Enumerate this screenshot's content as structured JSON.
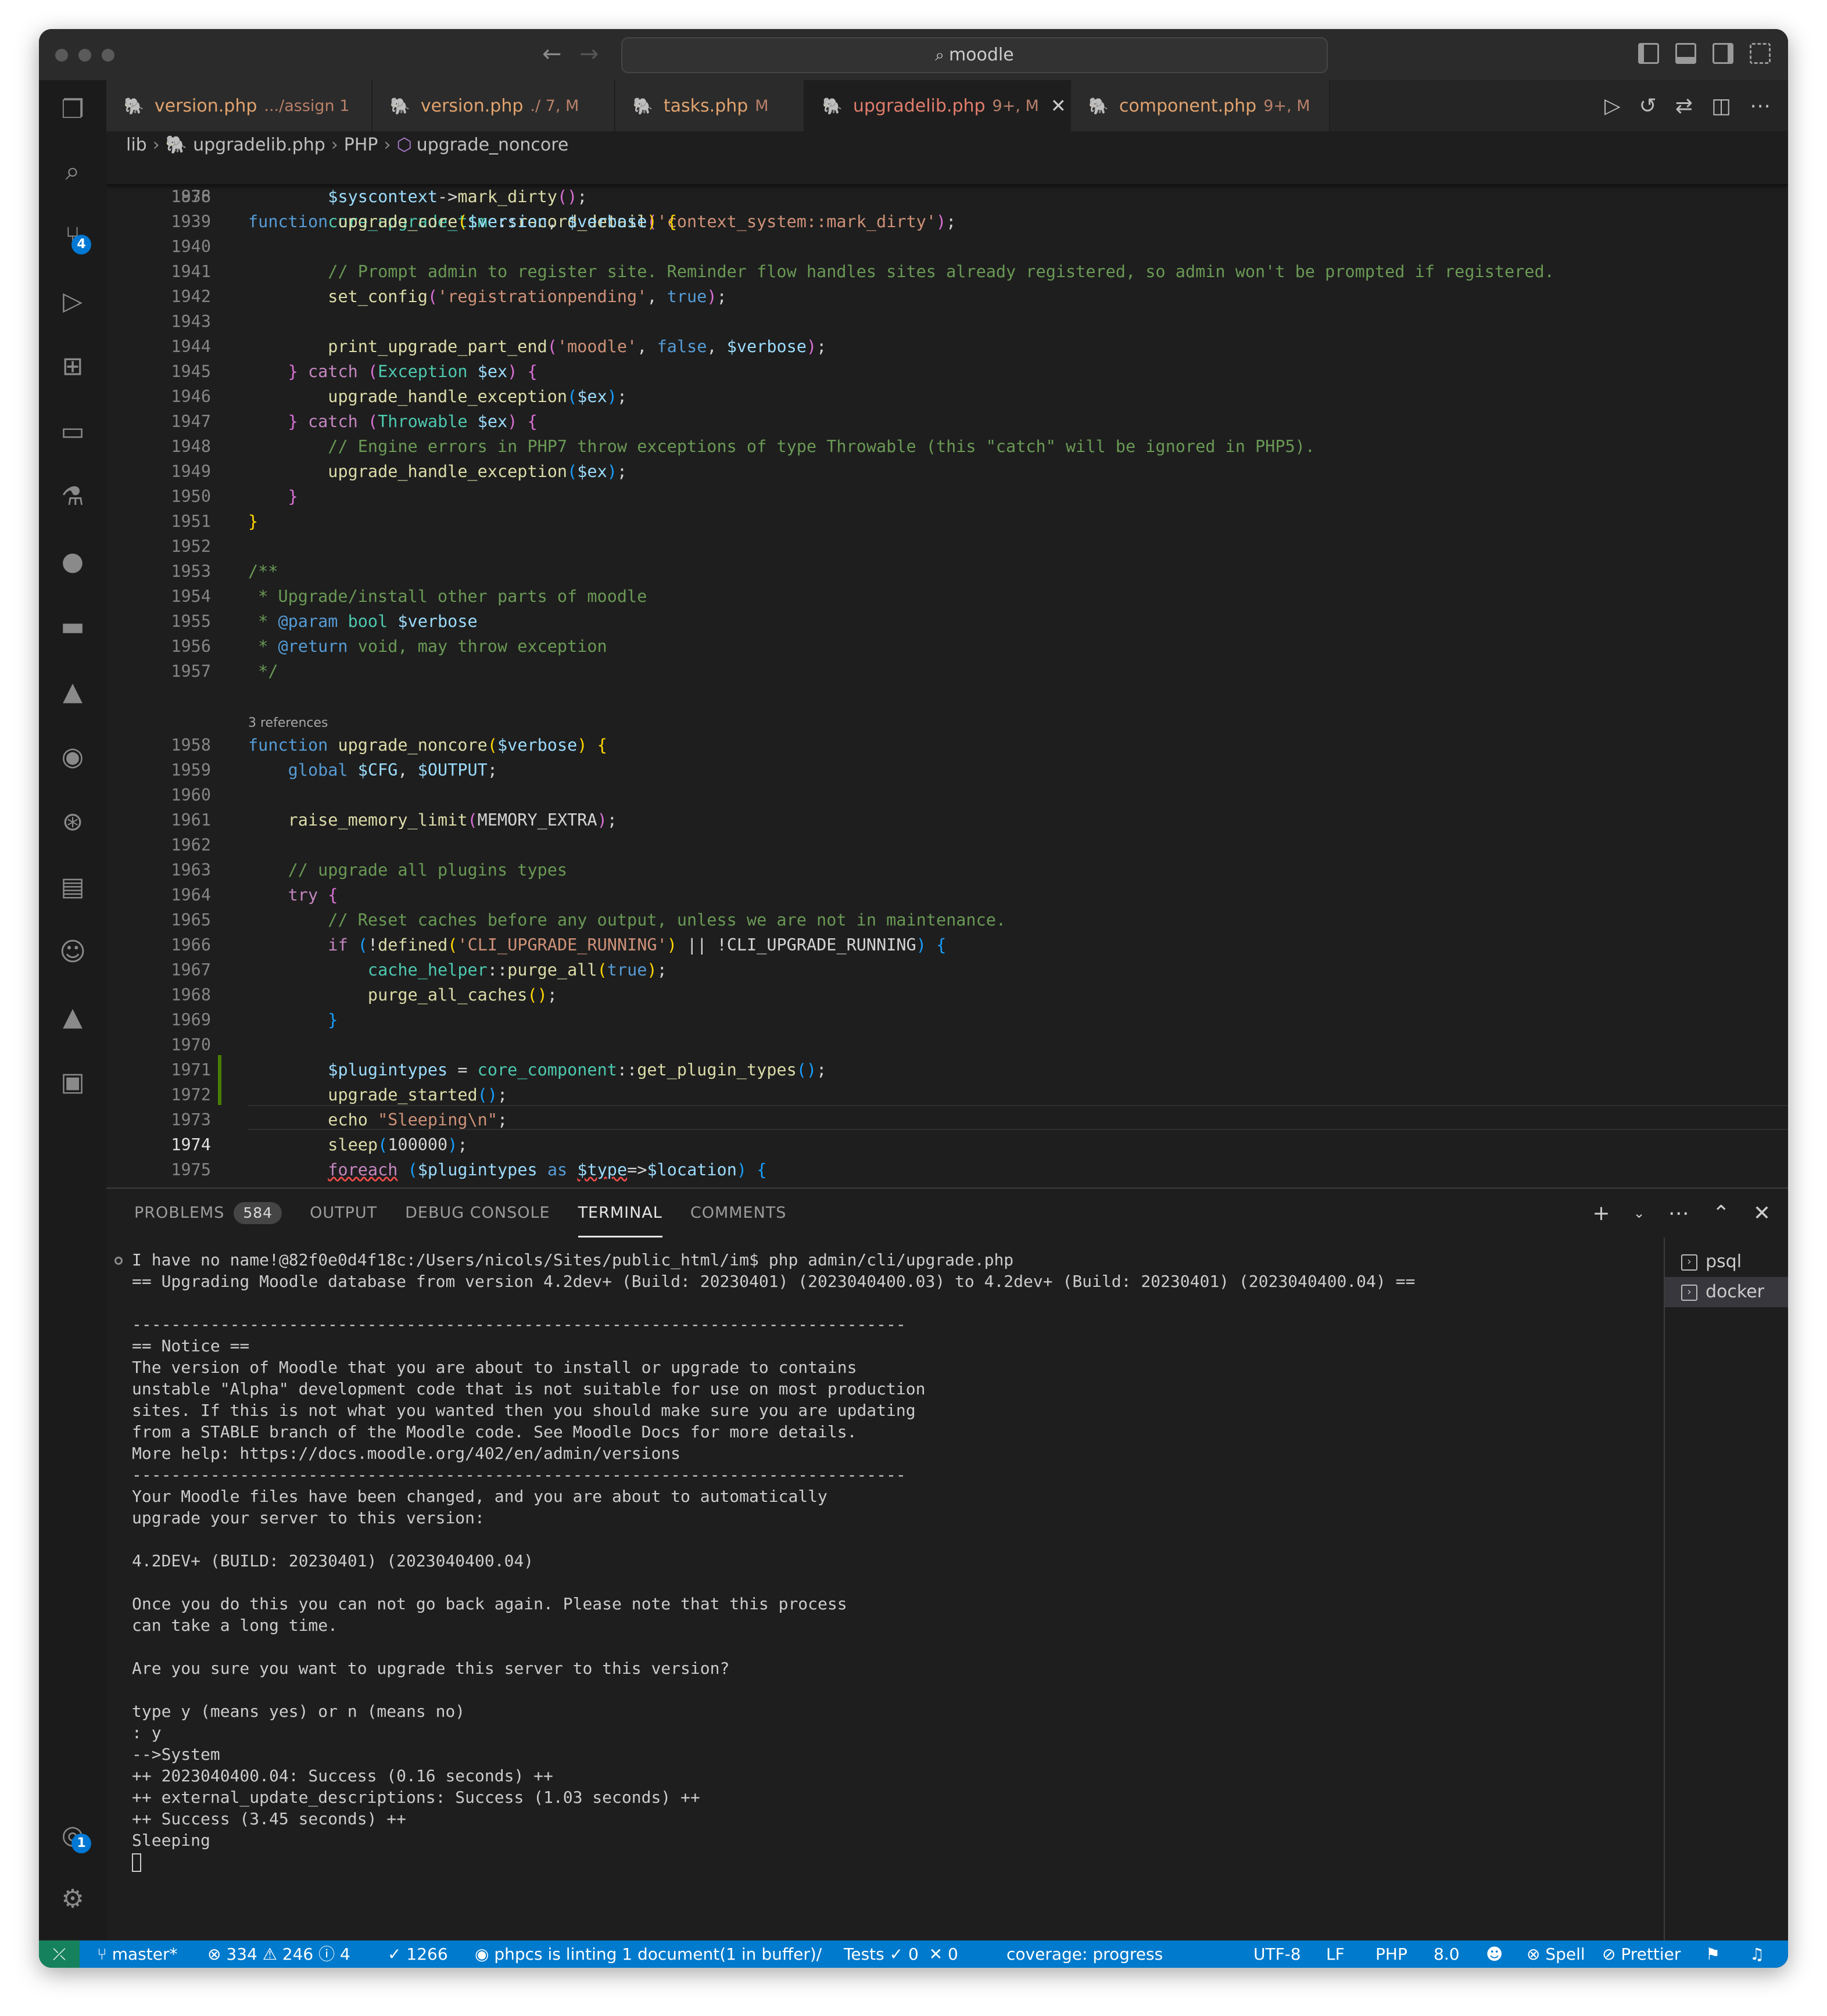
{
  "window": {
    "search_label": "moodle"
  },
  "tabs": [
    {
      "name": "version.php",
      "desc": ".../assign 1",
      "active": false
    },
    {
      "name": "version.php",
      "desc": "./ 7, M",
      "active": false
    },
    {
      "name": "tasks.php",
      "desc": "M",
      "active": false
    },
    {
      "name": "upgradelib.php",
      "desc": "9+, M",
      "active": true
    },
    {
      "name": "component.php",
      "desc": "9+, M",
      "active": false
    }
  ],
  "breadcrumb": {
    "folder": "lib",
    "file": "upgradelib.php",
    "language": "PHP",
    "symbol": "upgrade_noncore"
  },
  "editor": {
    "sticky_line": "1876",
    "line_numbers": [
      "1938",
      "1939",
      "1940",
      "1941",
      "1942",
      "1943",
      "1944",
      "1945",
      "1946",
      "1947",
      "1948",
      "1949",
      "1950",
      "1951",
      "1952",
      "1953",
      "1954",
      "1955",
      "1956",
      "1957",
      "1958",
      "1959",
      "1960",
      "1961",
      "1962",
      "1963",
      "1964",
      "1965",
      "1966",
      "1967",
      "1968",
      "1969",
      "1970",
      "1971",
      "1972",
      "1973",
      "1974",
      "1975"
    ],
    "current_line": "1974",
    "references_label": "3 references",
    "strings": {
      "s1": "'context_system::mark_dirty'",
      "s2": "'registrationpending'",
      "s3": "'moodle'",
      "s4": "'CLI_UPGRADE_RUNNING'",
      "s5": "\"Sleeping\\n\""
    },
    "comments": {
      "c1": "// Prompt admin to register site. Reminder flow handles sites already registered, so admin won't be prompted if registered.",
      "c2": "// Engine errors in PHP7 throw exceptions of type Throwable (this \"catch\" will be ignored in PHP5).",
      "c3": "/**",
      "c4": " * Upgrade/install other parts of moodle",
      "c5": " * ",
      "c5b": "@param",
      "c5c": " bool ",
      "c5d": "$verbose",
      "c6": " * ",
      "c6b": "@return",
      "c6c": " void, may throw exception",
      "c7": " */",
      "c8": "// upgrade all plugins types",
      "c9": "// Reset caches before any output, unless we are not in maintenance."
    },
    "numbers": {
      "n1": "100000"
    }
  },
  "panel": {
    "tabs": [
      {
        "label": "PROBLEMS",
        "badge": "584"
      },
      {
        "label": "OUTPUT"
      },
      {
        "label": "DEBUG CONSOLE"
      },
      {
        "label": "TERMINAL"
      },
      {
        "label": "COMMENTS"
      }
    ],
    "terminal_lines": [
      "I have no name!@82f0e0d4f18c:/Users/nicols/Sites/public_html/im$ php admin/cli/upgrade.php",
      "== Upgrading Moodle database from version 4.2dev+ (Build: 20230401) (2023040400.03) to 4.2dev+ (Build: 20230401) (2023040400.04) ==",
      "",
      "-------------------------------------------------------------------------------",
      "== Notice ==",
      "The version of Moodle that you are about to install or upgrade to contains",
      "unstable \"Alpha\" development code that is not suitable for use on most production",
      "sites. If this is not what you wanted then you should make sure you are updating",
      "from a STABLE branch of the Moodle code. See Moodle Docs for more details.",
      "More help: https://docs.moodle.org/402/en/admin/versions",
      "-------------------------------------------------------------------------------",
      "Your Moodle files have been changed, and you are about to automatically",
      "upgrade your server to this version:",
      "",
      "4.2DEV+ (BUILD: 20230401) (2023040400.04)",
      "",
      "Once you do this you can not go back again. Please note that this process",
      "can take a long time.",
      "",
      "Are you sure you want to upgrade this server to this version?",
      "",
      "type y (means yes) or n (means no)",
      ": y",
      "-->System",
      "++ 2023040400.04: Success (0.16 seconds) ++",
      "++ external_update_descriptions: Success (1.03 seconds) ++",
      "++ Success (3.45 seconds) ++",
      "Sleeping"
    ],
    "terminal_list": [
      "psql",
      "docker"
    ]
  },
  "activity_badges": {
    "scm": "4",
    "accounts": "1"
  },
  "status": {
    "branch": "master*",
    "errors": "334",
    "warnings": "246",
    "infos": "4",
    "checks": "1266",
    "linting": "phpcs is linting 1 document(1 in buffer)/",
    "tests_label": "Tests",
    "tests_passed": "0",
    "tests_failed": "0",
    "coverage": "coverage: progress",
    "encoding": "UTF-8",
    "eol": "LF",
    "language": "PHP",
    "php_version": "8.0",
    "spell": "Spell",
    "prettier": "Prettier"
  }
}
